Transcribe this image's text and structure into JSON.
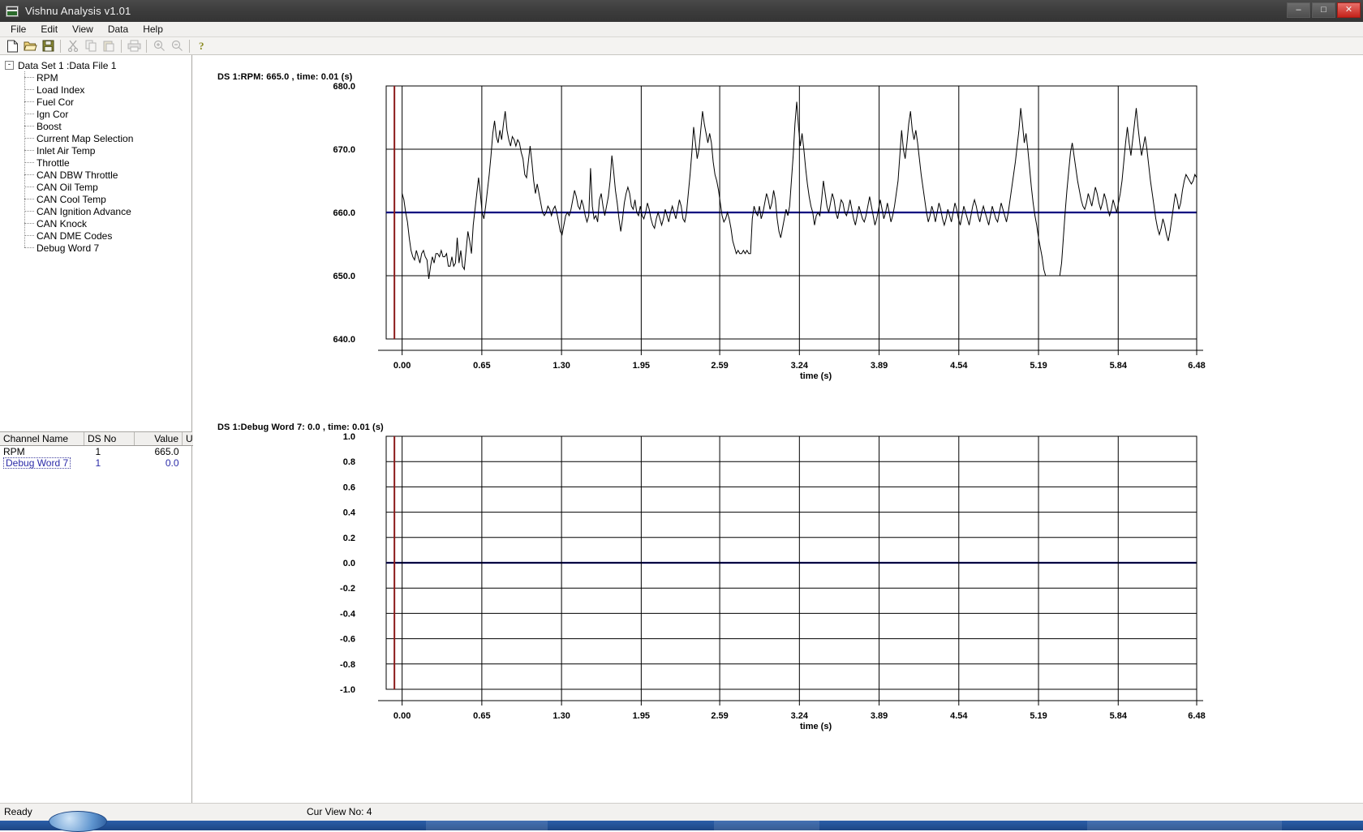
{
  "window": {
    "title": "Vishnu Analysis v1.01",
    "app_icon": "chart-app-icon",
    "minimize": "–",
    "maximize": "□",
    "close": "✕"
  },
  "menu": {
    "items": [
      "File",
      "Edit",
      "View",
      "Data",
      "Help"
    ]
  },
  "toolbar": {
    "buttons": [
      {
        "name": "new-icon",
        "glyph": "new"
      },
      {
        "name": "open-icon",
        "glyph": "open"
      },
      {
        "name": "save-icon",
        "glyph": "save"
      },
      {
        "name": "cut-icon",
        "glyph": "cut"
      },
      {
        "name": "copy-icon",
        "glyph": "copy"
      },
      {
        "name": "paste-icon",
        "glyph": "paste"
      },
      {
        "name": "print-icon",
        "glyph": "print"
      },
      {
        "name": "zoom-in-icon",
        "glyph": "zoomin"
      },
      {
        "name": "zoom-out-icon",
        "glyph": "zoomout"
      },
      {
        "name": "help-icon",
        "glyph": "help"
      }
    ]
  },
  "tree": {
    "root_label": "Data Set 1 :Data File 1",
    "expander": "-",
    "children": [
      "RPM",
      "Load Index",
      "Fuel Cor",
      "Ign Cor",
      "Boost",
      "Current Map Selection",
      "Inlet Air Temp",
      "Throttle",
      "CAN DBW Throttle",
      "CAN Oil Temp",
      "CAN Cool Temp",
      "CAN Ignition Advance",
      "CAN Knock",
      "CAN DME Codes",
      "Debug Word 7"
    ]
  },
  "channel_table": {
    "headers": [
      "Channel Name",
      "DS No",
      "Value",
      "Units"
    ],
    "rows": [
      {
        "name": "RPM",
        "ds_no": "1",
        "value": "665.0",
        "units": "",
        "selected": false
      },
      {
        "name": "Debug Word 7",
        "ds_no": "1",
        "value": "0.0",
        "units": "",
        "selected": true
      }
    ]
  },
  "statusbar": {
    "message": "Ready",
    "view_label": "Cur View No: 4"
  },
  "chart_data": [
    {
      "id": "rpm-plot",
      "type": "line",
      "title": "DS 1:RPM: 665.0  ,  time: 0.01 (s)",
      "xlabel": "time (s)",
      "ylabel": "",
      "ylim": [
        640.0,
        680.0
      ],
      "xlim": [
        -0.13,
        6.48
      ],
      "yticks": [
        "680.0",
        "670.0",
        "660.0",
        "650.0",
        "640.0"
      ],
      "ytick_values": [
        680.0,
        670.0,
        660.0,
        650.0,
        640.0
      ],
      "xticks": [
        "0.00",
        "0.65",
        "1.30",
        "1.95",
        "2.59",
        "3.24",
        "3.89",
        "4.54",
        "5.19",
        "5.84",
        "6.48"
      ],
      "xtick_values": [
        0.0,
        0.65,
        1.3,
        1.95,
        2.59,
        3.24,
        3.89,
        4.54,
        5.19,
        5.84,
        6.48
      ],
      "grid": true,
      "cursor_time": 0.01,
      "cursor_color": "#8B1A1A",
      "baseline_value": 660.0,
      "baseline_color": "#000080",
      "series": [
        {
          "name": "RPM",
          "color": "#000000",
          "values": [
            663.0,
            662.0,
            660.0,
            658.5,
            656.0,
            654.0,
            653.0,
            652.5,
            654.0,
            653.0,
            652.0,
            653.5,
            654.0,
            653.0,
            652.5,
            649.5,
            651.5,
            653.0,
            652.0,
            653.5,
            653.5,
            653.0,
            654.0,
            653.0,
            653.0,
            653.5,
            651.5,
            651.5,
            653.0,
            651.5,
            652.0,
            656.0,
            652.0,
            654.0,
            651.5,
            651.0,
            654.0,
            657.0,
            655.5,
            653.5,
            658.0,
            660.5,
            663.0,
            665.5,
            663.0,
            660.0,
            659.0,
            661.0,
            663.5,
            666.0,
            669.0,
            672.5,
            674.5,
            672.0,
            671.0,
            673.0,
            671.5,
            674.0,
            676.0,
            673.0,
            671.5,
            670.5,
            672.0,
            671.5,
            670.5,
            671.5,
            671.0,
            669.5,
            668.5,
            666.0,
            665.5,
            668.0,
            670.5,
            668.0,
            665.0,
            663.0,
            664.5,
            663.0,
            661.5,
            660.0,
            659.5,
            660.0,
            661.0,
            660.5,
            659.5,
            660.5,
            661.0,
            660.0,
            658.5,
            657.0,
            656.5,
            658.0,
            659.5,
            660.0,
            659.5,
            660.5,
            662.0,
            663.5,
            662.5,
            661.0,
            660.5,
            662.0,
            661.0,
            659.5,
            658.5,
            659.5,
            667.0,
            661.0,
            659.0,
            659.5,
            658.5,
            662.0,
            663.0,
            661.0,
            659.5,
            661.0,
            662.5,
            665.0,
            669.0,
            666.5,
            663.5,
            661.5,
            659.0,
            657.0,
            659.0,
            661.5,
            663.0,
            664.0,
            663.0,
            661.0,
            660.5,
            662.0,
            660.0,
            659.5,
            661.0,
            659.5,
            659.0,
            660.0,
            661.5,
            660.5,
            659.0,
            658.0,
            657.5,
            659.0,
            660.0,
            659.0,
            658.0,
            659.0,
            660.5,
            659.5,
            658.5,
            660.0,
            661.0,
            660.0,
            659.0,
            660.5,
            662.0,
            661.0,
            659.0,
            658.5,
            660.0,
            663.0,
            666.0,
            669.5,
            673.5,
            671.0,
            668.5,
            670.0,
            673.0,
            676.0,
            674.0,
            672.5,
            671.0,
            672.5,
            671.0,
            668.0,
            666.0,
            665.0,
            663.5,
            661.5,
            659.5,
            658.5,
            659.0,
            660.0,
            659.0,
            657.5,
            655.5,
            654.5,
            653.5,
            654.0,
            653.5,
            653.5,
            654.0,
            653.5,
            654.0,
            653.5,
            653.5,
            659.0,
            661.0,
            660.0,
            659.5,
            661.0,
            659.0,
            660.0,
            661.5,
            663.0,
            662.0,
            660.5,
            661.5,
            663.5,
            662.0,
            659.0,
            657.0,
            656.0,
            657.5,
            659.0,
            660.5,
            659.5,
            661.0,
            665.0,
            669.0,
            674.0,
            677.5,
            673.5,
            670.5,
            672.5,
            670.0,
            667.0,
            664.5,
            662.5,
            661.0,
            660.0,
            658.0,
            659.5,
            660.0,
            659.5,
            662.0,
            665.0,
            663.0,
            661.0,
            660.0,
            661.5,
            663.0,
            662.0,
            660.0,
            659.0,
            660.5,
            662.0,
            661.5,
            660.0,
            659.5,
            660.5,
            662.0,
            660.5,
            659.0,
            658.0,
            659.5,
            661.0,
            660.0,
            659.0,
            658.5,
            659.5,
            661.0,
            662.5,
            661.0,
            659.5,
            658.0,
            659.0,
            660.5,
            662.0,
            660.5,
            659.0,
            660.0,
            661.5,
            660.0,
            658.5,
            659.5,
            661.0,
            663.0,
            665.0,
            669.0,
            673.0,
            670.0,
            668.5,
            671.0,
            674.0,
            676.0,
            673.0,
            671.5,
            673.0,
            671.0,
            668.5,
            666.0,
            664.0,
            662.0,
            660.0,
            658.5,
            659.5,
            661.0,
            660.0,
            658.5,
            660.0,
            661.5,
            660.5,
            659.0,
            658.0,
            659.0,
            660.5,
            659.5,
            658.5,
            660.0,
            661.5,
            660.5,
            659.0,
            658.0,
            659.5,
            661.0,
            660.0,
            659.0,
            658.0,
            659.5,
            661.0,
            662.0,
            661.0,
            659.5,
            658.5,
            660.0,
            661.0,
            660.0,
            659.0,
            658.0,
            659.5,
            661.0,
            660.0,
            659.0,
            658.5,
            660.0,
            661.5,
            660.5,
            659.5,
            658.5,
            660.0,
            662.0,
            664.0,
            666.0,
            668.0,
            670.5,
            673.0,
            676.5,
            674.0,
            671.0,
            672.5,
            670.0,
            667.0,
            664.0,
            661.5,
            659.5,
            658.0,
            656.0,
            654.5,
            653.0,
            651.0,
            650.0,
            650.0,
            650.0,
            650.0,
            650.0,
            650.0,
            650.0,
            650.0,
            650.0,
            652.0,
            656.0,
            660.0,
            663.5,
            666.5,
            669.5,
            671.0,
            669.0,
            667.0,
            665.0,
            663.5,
            662.0,
            661.0,
            660.5,
            661.5,
            663.0,
            662.0,
            661.0,
            662.5,
            664.0,
            663.0,
            661.5,
            660.5,
            661.5,
            663.0,
            662.0,
            660.5,
            659.5,
            660.5,
            662.0,
            661.0,
            660.0,
            661.5,
            663.0,
            665.0,
            668.0,
            671.0,
            673.5,
            671.0,
            669.0,
            671.5,
            674.0,
            676.5,
            673.5,
            671.0,
            669.0,
            670.5,
            672.0,
            670.0,
            667.5,
            665.0,
            663.0,
            661.0,
            659.0,
            657.5,
            656.5,
            657.5,
            659.0,
            658.0,
            656.5,
            655.5,
            657.0,
            659.0,
            661.0,
            663.0,
            662.0,
            660.5,
            661.5,
            663.5,
            665.0,
            666.0,
            665.5,
            665.0,
            664.5,
            665.0,
            666.0,
            665.5
          ]
        }
      ]
    },
    {
      "id": "debug-word-7-plot",
      "type": "line",
      "title": "DS 1:Debug Word 7: 0.0  ,  time: 0.01 (s)",
      "xlabel": "time (s)",
      "ylabel": "",
      "ylim": [
        -1.0,
        1.0
      ],
      "xlim": [
        -0.13,
        6.48
      ],
      "yticks": [
        "1.0",
        "0.8",
        "0.6",
        "0.4",
        "0.2",
        "0.0",
        "-0.2",
        "-0.4",
        "-0.6",
        "-0.8",
        "-1.0"
      ],
      "ytick_values": [
        1.0,
        0.8,
        0.6,
        0.4,
        0.2,
        0.0,
        -0.2,
        -0.4,
        -0.6,
        -0.8,
        -1.0
      ],
      "xticks": [
        "0.00",
        "0.65",
        "1.30",
        "1.95",
        "2.59",
        "3.24",
        "3.89",
        "4.54",
        "5.19",
        "5.84",
        "6.48"
      ],
      "xtick_values": [
        0.0,
        0.65,
        1.3,
        1.95,
        2.59,
        3.24,
        3.89,
        4.54,
        5.19,
        5.84,
        6.48
      ],
      "grid": true,
      "cursor_time": 0.01,
      "cursor_color": "#8B1A1A",
      "baseline_value": 0.0,
      "baseline_color": "#000080",
      "series": [
        {
          "name": "Debug Word 7",
          "color": "#000000",
          "constant_value": 0.0
        }
      ]
    }
  ]
}
